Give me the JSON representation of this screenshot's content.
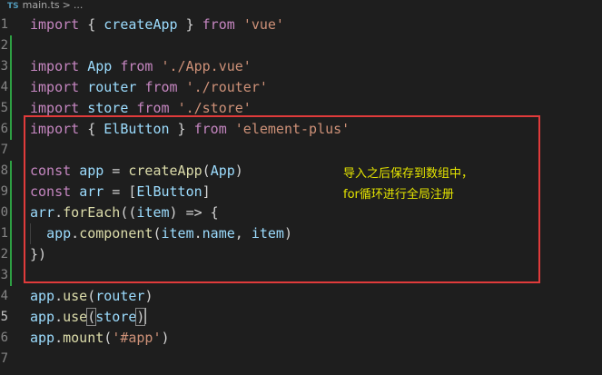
{
  "breadcrumb": {
    "file_icon": "TS",
    "file_name": "main.ts",
    "separator": ">",
    "more": "..."
  },
  "line_numbers": [
    "1",
    "2",
    "3",
    "4",
    "5",
    "6",
    "7",
    "8",
    "9",
    "0",
    "1",
    "2",
    "3",
    "4",
    "5",
    "6",
    "7"
  ],
  "active_line_number": "5",
  "code": {
    "l1": {
      "kw1": "import",
      "brace_open": " { ",
      "name": "createApp",
      "brace_close": " } ",
      "kw2": "from",
      "sp": " ",
      "src": "'vue'"
    },
    "l3": {
      "kw1": "import",
      "sp1": " ",
      "name": "App",
      "sp2": " ",
      "kw2": "from",
      "sp3": " ",
      "src": "'./App.vue'"
    },
    "l4": {
      "kw1": "import",
      "sp1": " ",
      "name": "router",
      "sp2": " ",
      "kw2": "from",
      "sp3": " ",
      "src": "'./router'"
    },
    "l5": {
      "kw1": "import",
      "sp1": " ",
      "name": "store",
      "sp2": " ",
      "kw2": "from",
      "sp3": " ",
      "src": "'./store'"
    },
    "l6": {
      "kw1": "import",
      "brace_open": " { ",
      "name": "ElButton",
      "brace_close": " } ",
      "kw2": "from",
      "sp": " ",
      "src": "'element-plus'"
    },
    "l8": {
      "kw": "const",
      "sp1": " ",
      "var": "app",
      "eq": " = ",
      "fn": "createApp",
      "open": "(",
      "arg": "App",
      "close": ")"
    },
    "l9": {
      "kw": "const",
      "sp1": " ",
      "var": "arr",
      "eq": " = [",
      "arg": "ElButton",
      "close": "]"
    },
    "l10": {
      "var": "arr",
      "dot": ".",
      "fn": "forEach",
      "open": "((",
      "param": "item",
      "arrow": ") => {"
    },
    "l11": {
      "indent": "  ",
      "var": "app",
      "dot": ".",
      "fn": "component",
      "open": "(",
      "obj": "item",
      "dot2": ".",
      "prop": "name",
      "comma": ", ",
      "arg": "item",
      "close": ")"
    },
    "l12": {
      "text": "})"
    },
    "l14": {
      "var": "app",
      "dot": ".",
      "fn": "use",
      "open": "(",
      "arg": "router",
      "close": ")"
    },
    "l15": {
      "var": "app",
      "dot": ".",
      "fn": "use",
      "open": "(",
      "arg": "store",
      "close": ")"
    },
    "l16": {
      "var": "app",
      "dot": ".",
      "fn": "mount",
      "open": "(",
      "arg": "'#app'",
      "close": ")"
    }
  },
  "annotation": {
    "line1": "导入之后保存到数组中，",
    "line2": "for循环进行全局注册"
  },
  "colors": {
    "background": "#1e1e1e",
    "keyword": "#c586c0",
    "string": "#ce9178",
    "variable": "#9cdcfe",
    "function": "#dcdcaa",
    "git_added": "#2ea043",
    "annotation_border": "#e03b3b",
    "annotation_text": "#e5e500"
  }
}
